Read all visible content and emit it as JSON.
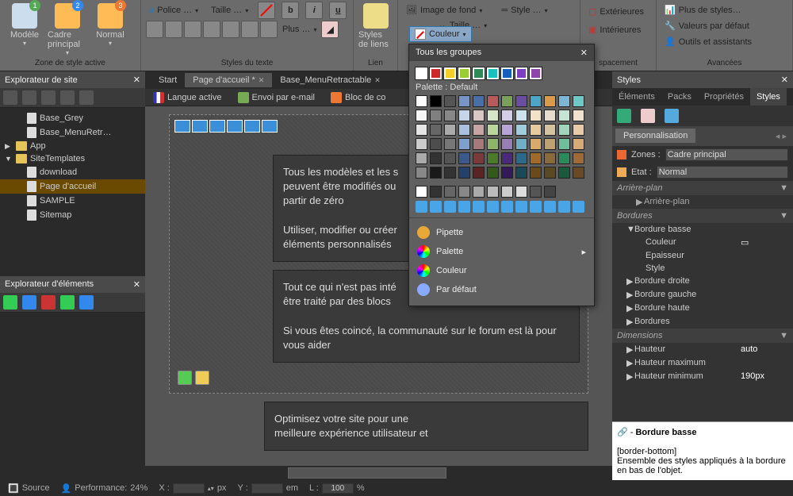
{
  "ribbon": {
    "groups": [
      {
        "label": "Zone de style active",
        "buttons": [
          "Modèle",
          "Cadre principal",
          "Normal"
        ],
        "badges": [
          "1",
          "2",
          "3"
        ]
      },
      {
        "label": "Styles du texte",
        "font_label": "Police …",
        "size_label": "Taille …",
        "plus": "Plus …"
      },
      {
        "label": "Lien",
        "btn": "Styles de liens"
      },
      {
        "label": "",
        "items": [
          "Image de fond",
          "Couleur",
          "Style …",
          "Taille …"
        ]
      },
      {
        "label": "spacement",
        "items": [
          "Extérieures",
          "Intérieures"
        ]
      },
      {
        "label": "Avancées",
        "items": [
          "Plus de styles…",
          "Valeurs par défaut",
          "Outils et assistants"
        ]
      }
    ]
  },
  "tabs": [
    {
      "label": "Start",
      "active": false
    },
    {
      "label": "Page d'accueil *",
      "active": true
    },
    {
      "label": "Base_MenuRetractable",
      "active": false
    }
  ],
  "left": {
    "site_title": "Explorateur de site",
    "items": [
      {
        "label": "Base_Grey",
        "icon": "pi",
        "lvl": 1
      },
      {
        "label": "Base_MenuRetr…",
        "icon": "pi",
        "lvl": 1
      },
      {
        "label": "App",
        "icon": "fi",
        "lvl": 0,
        "exp": "▶"
      },
      {
        "label": "SiteTemplates",
        "icon": "fi",
        "lvl": 0,
        "exp": "▼"
      },
      {
        "label": "download",
        "icon": "pi",
        "lvl": 1
      },
      {
        "label": "Page d'accueil",
        "icon": "pi",
        "lvl": 1,
        "sel": true
      },
      {
        "label": "SAMPLE",
        "icon": "pi",
        "lvl": 1
      },
      {
        "label": "Sitemap",
        "icon": "pi",
        "lvl": 1
      }
    ],
    "elem_title": "Explorateur d'éléments"
  },
  "doc_toolbar": [
    {
      "label": "Langue active"
    },
    {
      "label": "Envoi par e-mail"
    },
    {
      "label": "Bloc de co"
    }
  ],
  "blocks": [
    "Tous les modèles et les s\npeuvent être modifiés ou\npartir de zéro\n\nUtiliser, modifier ou créer\néléments personnalisés",
    "Tout ce qui n'est pas inté\nêtre traité par des blocs\n\nSi vous êtes coincé, la communauté sur le forum est là pour vous aider",
    "Optimisez votre site pour une\nmeilleure expérience utilisateur et"
  ],
  "right": {
    "title": "Styles",
    "tabs": [
      "Éléments",
      "Packs",
      "Propriétés",
      "Styles"
    ],
    "active_tab": 3,
    "subtab": "Personnalisation",
    "zone_label": "Zones :",
    "zone_value": "Cadre principal",
    "etat_label": "Etat :",
    "etat_value": "Normal",
    "props": [
      {
        "cat": "Arrière-plan"
      },
      {
        "sub": "Arrière-plan",
        "dim": true
      },
      {
        "cat": "Bordures"
      },
      {
        "sub": "Bordure basse",
        "open": true
      },
      {
        "subsub": "Couleur",
        "val": "▭"
      },
      {
        "subsub": "Epaisseur"
      },
      {
        "subsub": "Style"
      },
      {
        "sub": "Bordure droite"
      },
      {
        "sub": "Bordure gauche"
      },
      {
        "sub": "Bordure haute"
      },
      {
        "sub": "Bordures"
      },
      {
        "cat": "Dimensions"
      },
      {
        "sub": "Hauteur",
        "val": "auto"
      },
      {
        "sub": "Hauteur maximum"
      },
      {
        "sub": "Hauteur minimum",
        "val": "190px"
      }
    ],
    "help_title": "Bordure basse",
    "help_code": "[border-bottom]",
    "help_text": "Ensemble des styles appliqués à la bordure en bas de l'objet."
  },
  "status": {
    "source": "Source",
    "perf_label": "Performance:",
    "perf_val": "24%",
    "x": "X :",
    "px": "px",
    "y": "Y :",
    "em": "em",
    "l": "L :",
    "lval": "100",
    "pct": "%"
  },
  "popup": {
    "title": "Tous les groupes",
    "palette_label": "Palette : Default",
    "rows_top": [
      [
        "#fff",
        "#cc2a2a",
        "#f5cf28",
        "#9acd32",
        "#2e8b57",
        "#1bbfbf",
        "#1560bd",
        "#7b3fbf",
        "#8e44ad"
      ]
    ],
    "grid": [
      [
        "#ffffff",
        "#000000",
        "#555",
        "#7795c9",
        "#496fa8",
        "#b85a5a",
        "#7aa05a",
        "#6a4fa0",
        "#4aa5c7",
        "#d99a4a",
        "#7db5d5",
        "#6fc7c7"
      ],
      [
        "#f5f5f5",
        "#808080",
        "#888",
        "#c7d5ea",
        "#d9c7c7",
        "#d9e5c7",
        "#d5cce8",
        "#cce3ec",
        "#f3e2c7",
        "#e8dccc",
        "#c7e3d5",
        "#f3e2d0"
      ],
      [
        "#e5e5e5",
        "#666",
        "#aaa",
        "#a9c0df",
        "#c7a5a5",
        "#bcd59c",
        "#b8a5d5",
        "#a0cddc",
        "#e8caa0",
        "#d5c3a0",
        "#a0d5bc",
        "#e8caa8"
      ],
      [
        "#ccc",
        "#4d4d4d",
        "#777",
        "#7fa0cf",
        "#a57a7a",
        "#8fb56a",
        "#977fb5",
        "#6fb0c7",
        "#d9aa6a",
        "#bfa070",
        "#70bf9c",
        "#d9aa78"
      ],
      [
        "#aaa",
        "#333",
        "#555",
        "#3a5a8e",
        "#7a3a3a",
        "#4a7a2a",
        "#4a2a7a",
        "#2a6a8a",
        "#a06a2a",
        "#8a6a3a",
        "#2a8a5a",
        "#a06a38"
      ],
      [
        "#888",
        "#1a1a1a",
        "#333",
        "#24416a",
        "#5a2424",
        "#335a1a",
        "#331a5a",
        "#1a4a5a",
        "#6a4a1a",
        "#5a4a24",
        "#1a5a3a",
        "#6a4a24"
      ]
    ],
    "recent": [
      "#fff",
      "#333",
      "#666",
      "#888",
      "#aaa",
      "#bbb",
      "#ccc",
      "#ddd",
      "#555",
      "#444"
    ],
    "items": [
      {
        "label": "Pipette",
        "ico": "#e8a838"
      },
      {
        "label": "Palette",
        "ico": "conic",
        "arrow": true
      },
      {
        "label": "Couleur",
        "ico": "conic",
        "select": true
      },
      {
        "label": "Par défaut",
        "ico": "#88aaff"
      }
    ],
    "couleur_btn": "Couleur"
  }
}
